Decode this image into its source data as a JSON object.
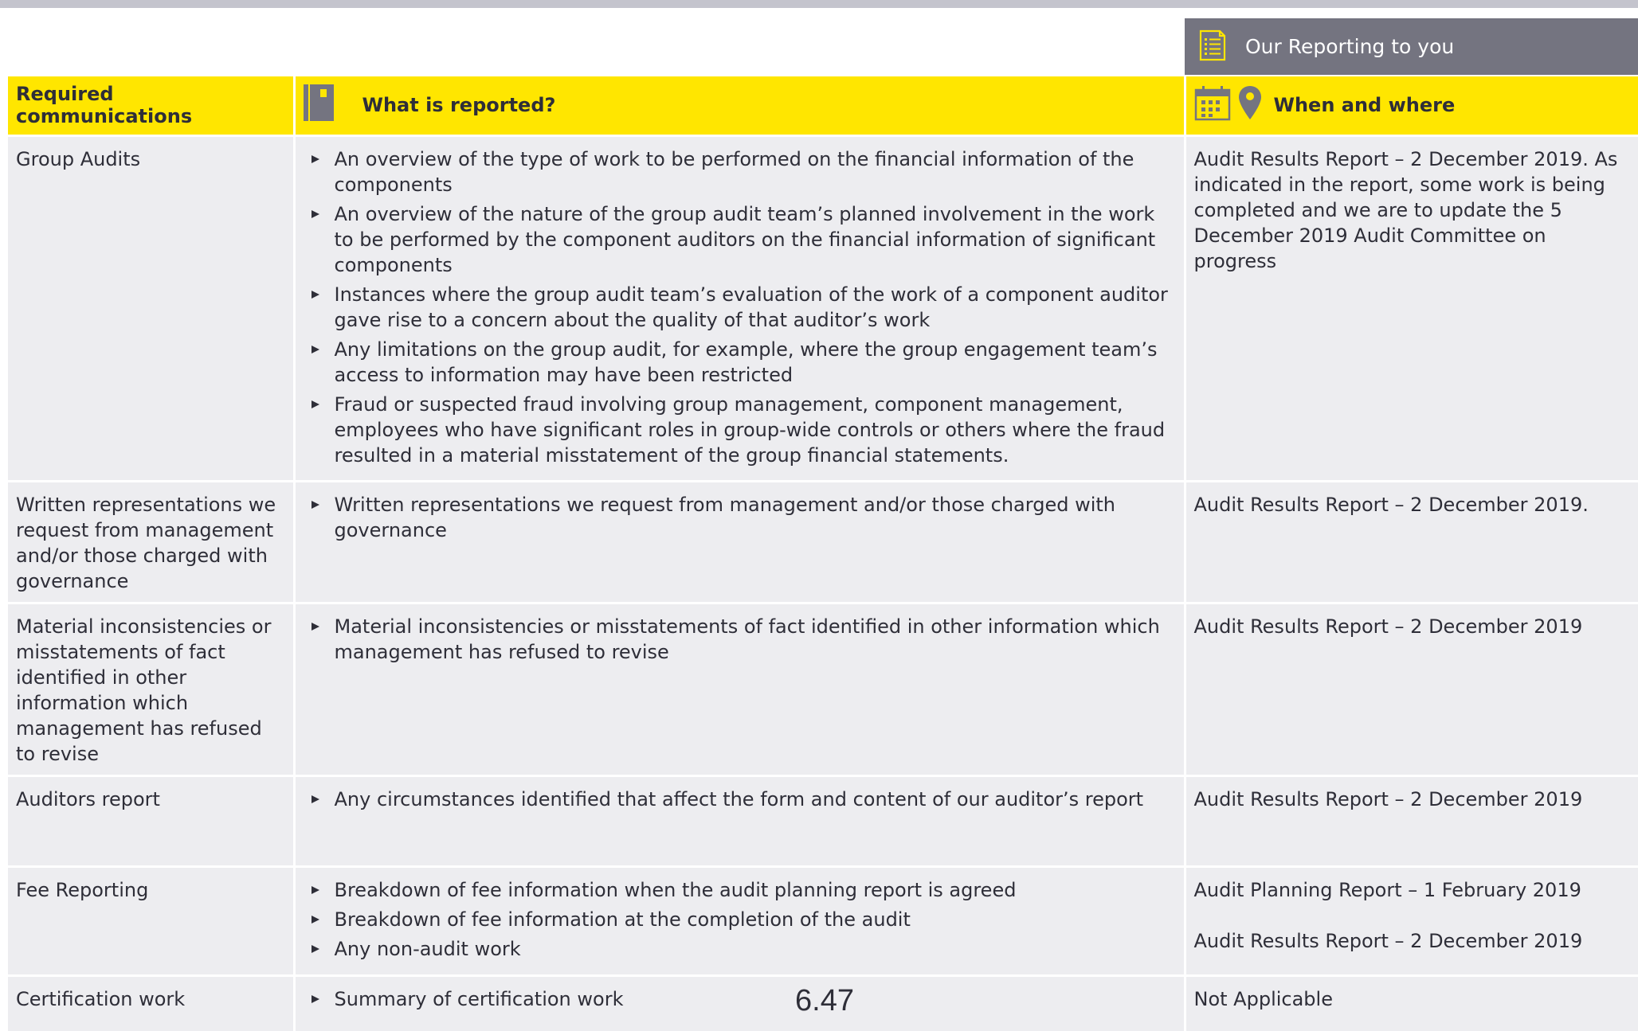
{
  "ribbon": {
    "title": "Our Reporting to you",
    "icon": "report-list-icon"
  },
  "headers": {
    "col1": "Required communications",
    "col2": "What is reported?",
    "col3": "When and where"
  },
  "colors": {
    "header_yellow": "#ffe600",
    "ribbon_grey": "#747480",
    "cell_grey": "#ededf0",
    "text": "#2e2e38"
  },
  "rows": [
    {
      "label": "Group Audits",
      "items": [
        "An overview of the type of work to be performed on the financial information of the components",
        "An overview of the nature of the group audit team’s planned involvement in the work to be performed by the component auditors on the financial information of significant components",
        "Instances where the group audit team’s evaluation of the work of a component auditor gave rise to a concern about the quality of that auditor’s work",
        "Any limitations on the group audit, for example, where the group engagement team’s access to information may have been restricted",
        "Fraud or suspected fraud involving group management, component management, employees who have significant roles in group-wide controls or others where the fraud resulted in a material misstatement of the group financial statements."
      ],
      "when": [
        "Audit Results Report – 2 December 2019. As indicated in the report, some work is being completed and we are to update the 5 December 2019 Audit Committee on progress"
      ]
    },
    {
      "label": "Written representations we request from management and/or those charged with governance",
      "items": [
        "Written representations we request from management and/or those charged with governance"
      ],
      "when": [
        "Audit Results Report – 2 December 2019."
      ]
    },
    {
      "label": "Material inconsistencies or misstatements of fact identified in other information which management has refused to revise",
      "items": [
        "Material inconsistencies or misstatements of fact identified in other information which management has refused to revise"
      ],
      "when": [
        "Audit Results Report – 2 December 2019"
      ]
    },
    {
      "label": "Auditors report",
      "items": [
        "Any circumstances identified that affect the form and content of our auditor’s report"
      ],
      "when": [
        "Audit Results Report – 2 December 2019"
      ]
    },
    {
      "label": "Fee Reporting",
      "items": [
        "Breakdown of fee information when the  audit planning report is agreed",
        "Breakdown of fee information at the completion of the audit",
        "Any non-audit work"
      ],
      "when": [
        "Audit Planning Report – 1 February 2019",
        "Audit Results Report – 2 December 2019"
      ]
    },
    {
      "label": "Certification work",
      "items": [
        "Summary of certification work"
      ],
      "when": [
        "Not Applicable"
      ]
    }
  ],
  "page_number": "6.47"
}
